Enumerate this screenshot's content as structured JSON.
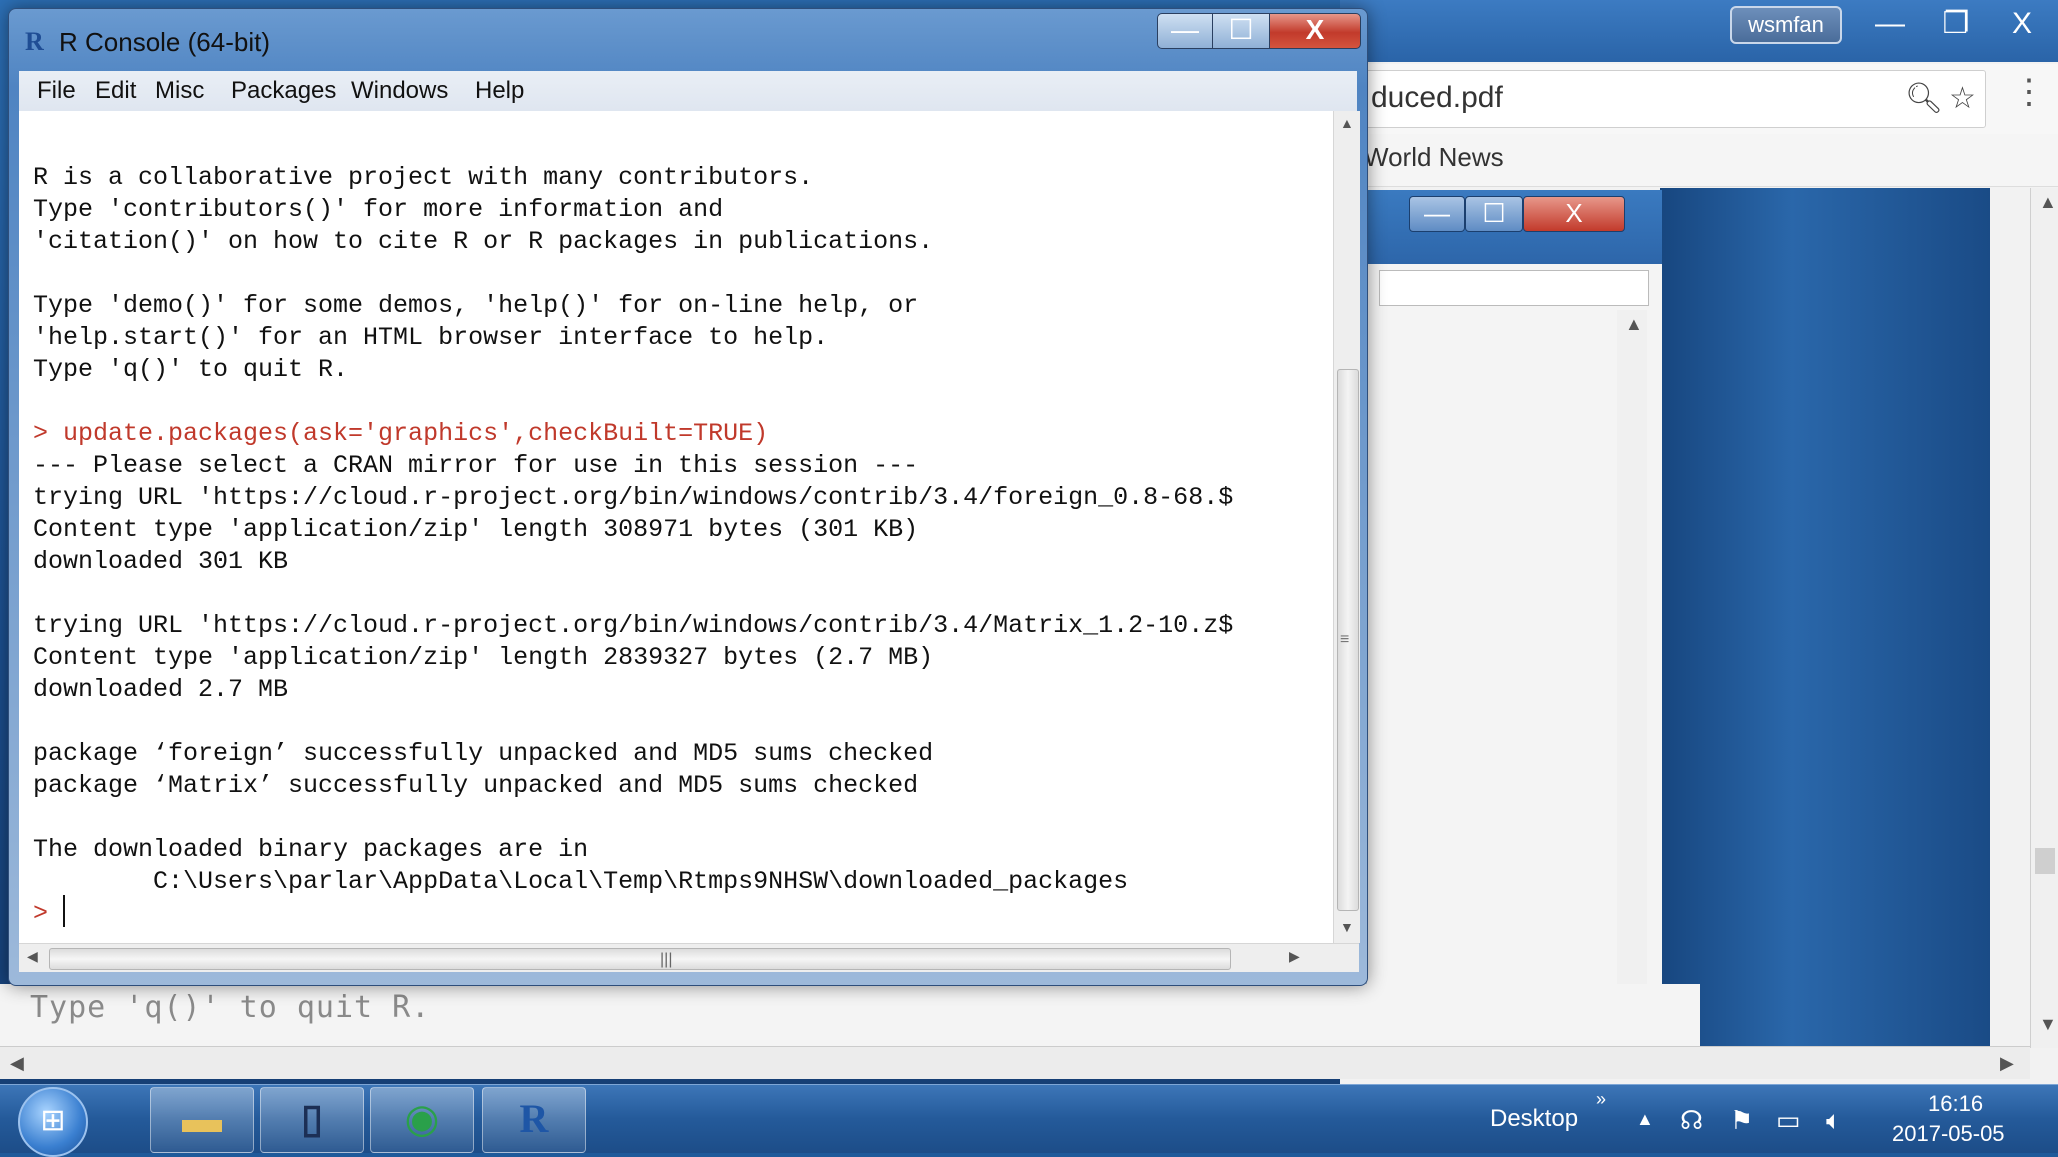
{
  "r_console": {
    "title": "R Console (64-bit)",
    "icon_letter": "R",
    "window_buttons": {
      "minimize": "—",
      "maximize": "☐",
      "close": "X"
    },
    "menu": [
      "File",
      "Edit",
      "Misc",
      "Packages",
      "Windows",
      "Help"
    ],
    "lines": [
      "R is a collaborative project with many contributors.",
      "Type 'contributors()' for more information and",
      "'citation()' on how to cite R or R packages in publications.",
      "",
      "Type 'demo()' for some demos, 'help()' for on-line help, or",
      "'help.start()' for an HTML browser interface to help.",
      "Type 'q()' to quit R.",
      "",
      "> update.packages(ask='graphics',checkBuilt=TRUE)",
      "--- Please select a CRAN mirror for use in this session ---",
      "trying URL 'https://cloud.r-project.org/bin/windows/contrib/3.4/foreign_0.8-68.$",
      "Content type 'application/zip' length 308971 bytes (301 KB)",
      "downloaded 301 KB",
      "",
      "trying URL 'https://cloud.r-project.org/bin/windows/contrib/3.4/Matrix_1.2-10.z$",
      "Content type 'application/zip' length 2839327 bytes (2.7 MB)",
      "downloaded 2.7 MB",
      "",
      "package ‘foreign’ successfully unpacked and MD5 sums checked",
      "package ‘Matrix’ successfully unpacked and MD5 sums checked",
      "",
      "The downloaded binary packages are in",
      "        C:\\Users\\parlar\\AppData\\Local\\Temp\\Rtmps9NHSW\\downloaded_packages"
    ],
    "prompt": ">",
    "colors": {
      "command": "#c0392b",
      "output": "#111111"
    }
  },
  "chrome": {
    "profile": "wsmfan",
    "address": "duced.pdf",
    "bookmark": "World News",
    "window_buttons": {
      "minimize": "—",
      "maximize": "❐",
      "close": "X"
    }
  },
  "inner_window": {
    "window_buttons": {
      "minimize": "—",
      "maximize": "☐",
      "close": "X"
    }
  },
  "underlying_text": "Type 'q()' to quit R.",
  "taskbar": {
    "apps": [
      "folder-icon",
      "notebook-icon",
      "chrome-icon",
      "r-icon"
    ],
    "r_letter": "R",
    "desktop_label": "Desktop",
    "chevron": "»",
    "clock": {
      "time": "16:16",
      "date": "2017-05-05"
    }
  }
}
